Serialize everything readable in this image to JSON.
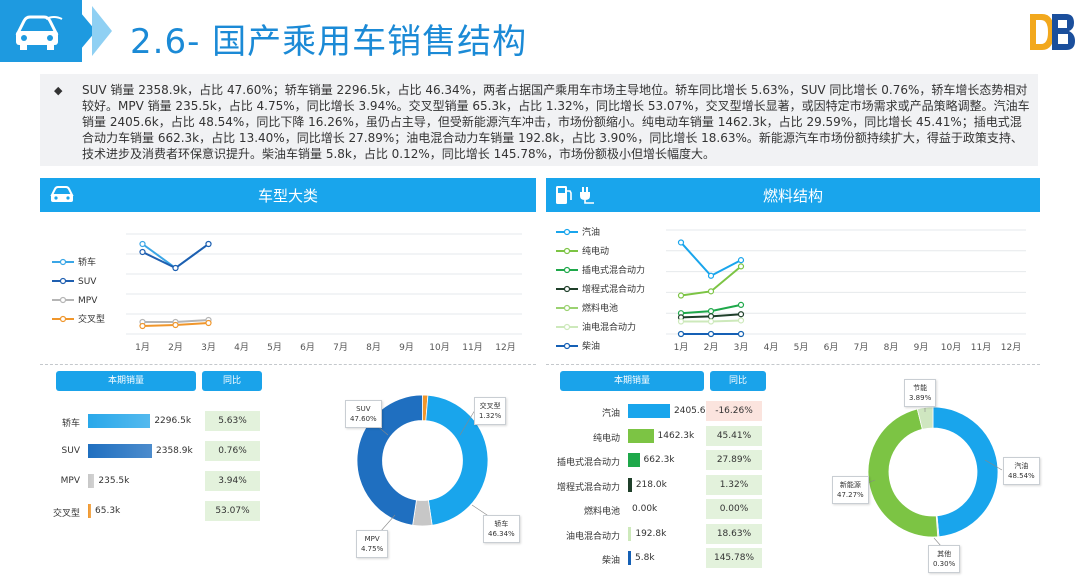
{
  "header": {
    "title": "2.6- 国产乘用车销售结构"
  },
  "summary": {
    "text": "SUV 销量 2358.9k，占比 47.60%；轿车销量 2296.5k，占比 46.34%，两者占据国产乘用车市场主导地位。轿车同比增长 5.63%，SUV 同比增长 0.76%，轿车增长态势相对较好。MPV 销量 235.5k，占比 4.75%，同比增长 3.94%。交叉型销量 65.3k，占比 1.32%，同比增长 53.07%，交叉型增长显著，或因特定市场需求或产品策略调整。汽油车销量 2405.6k，占比 48.54%，同比下降 16.26%，虽仍占主导，但受新能源汽车冲击，市场份额缩小。纯电动车销量 1462.3k，占比 29.59%，同比增长 45.41%；插电式混合动力车销量 662.3k，占比 13.40%，同比增长 27.89%；油电混合动力车销量 192.8k，占比 3.90%，同比增长 18.63%。新能源汽车市场份额持续扩大，得益于政策支持、技术进步及消费者环保意识提升。柴油车销量 5.8k，占比 0.12%，同比增长 145.78%，市场份额极小但增长幅度大。"
  },
  "left": {
    "banner_title": "车型大类",
    "col_sales": "本期销量",
    "col_yoy": "同比",
    "rows": [
      {
        "label": "轿车",
        "sales": "2296.5k",
        "yoy": "5.63%",
        "fraction": 0.974
      },
      {
        "label": "SUV",
        "sales": "2358.9k",
        "yoy": "0.76%",
        "fraction": 1.0
      },
      {
        "label": "MPV",
        "sales": "235.5k",
        "yoy": "3.94%",
        "fraction": 0.1
      },
      {
        "label": "交叉型",
        "sales": "65.3k",
        "yoy": "53.07%",
        "fraction": 0.028
      }
    ],
    "donut_labels": [
      {
        "name": "SUV",
        "pct": "47.60%"
      },
      {
        "name": "交叉型",
        "pct": "1.32%"
      },
      {
        "name": "MPV",
        "pct": "4.75%"
      },
      {
        "name": "轿车",
        "pct": "46.34%"
      }
    ]
  },
  "right": {
    "banner_title": "燃料结构",
    "col_sales": "本期销量",
    "col_yoy": "同比",
    "rows": [
      {
        "label": "汽油",
        "sales": "2405.6k",
        "yoy": "-16.26%",
        "fraction": 1.0
      },
      {
        "label": "纯电动",
        "sales": "1462.3k",
        "yoy": "45.41%",
        "fraction": 0.608
      },
      {
        "label": "插电式混合动力",
        "sales": "662.3k",
        "yoy": "27.89%",
        "fraction": 0.275
      },
      {
        "label": "增程式混合动力",
        "sales": "218.0k",
        "yoy": "1.32%",
        "fraction": 0.091
      },
      {
        "label": "燃料电池",
        "sales": "0.00k",
        "yoy": "0.00%",
        "fraction": 0.0
      },
      {
        "label": "油电混合动力",
        "sales": "192.8k",
        "yoy": "18.63%",
        "fraction": 0.08
      },
      {
        "label": "柴油",
        "sales": "5.8k",
        "yoy": "145.78%",
        "fraction": 0.0024
      }
    ],
    "donut_labels": [
      {
        "name": "节能",
        "pct": "3.89%"
      },
      {
        "name": "汽油",
        "pct": "48.54%"
      },
      {
        "name": "新能源",
        "pct": "47.27%"
      },
      {
        "name": "其他",
        "pct": "0.30%"
      }
    ]
  },
  "chart_data": [
    {
      "type": "line",
      "categories": [
        "1月",
        "2月",
        "3月",
        "4月",
        "5月",
        "6月",
        "7月",
        "8月",
        "9月",
        "10月",
        "11月",
        "12月"
      ],
      "series": [
        {
          "name": "轿车",
          "values": [
            0.9,
            0.66,
            0.9
          ],
          "color": "#3aa6e6"
        },
        {
          "name": "SUV",
          "values": [
            0.82,
            0.66,
            0.9
          ],
          "color": "#1f5fb0"
        },
        {
          "name": "MPV",
          "values": [
            0.12,
            0.12,
            0.14
          ],
          "color": "#b5b5b5"
        },
        {
          "name": "交叉型",
          "values": [
            0.08,
            0.09,
            0.11
          ],
          "color": "#f0962b"
        }
      ],
      "grid": true,
      "legend": "left"
    },
    {
      "type": "line",
      "categories": [
        "1月",
        "2月",
        "3月",
        "4月",
        "5月",
        "6月",
        "7月",
        "8月",
        "9月",
        "10月",
        "11月",
        "12月"
      ],
      "series": [
        {
          "name": "汽油",
          "values": [
            0.88,
            0.56,
            0.71
          ],
          "color": "#19a5ec"
        },
        {
          "name": "纯电动",
          "values": [
            0.37,
            0.41,
            0.65
          ],
          "color": "#7cc444"
        },
        {
          "name": "插电式混合动力",
          "values": [
            0.2,
            0.22,
            0.28
          ],
          "color": "#1ea84a"
        },
        {
          "name": "增程式混合动力",
          "values": [
            0.16,
            0.17,
            0.19
          ],
          "color": "#1f3f2a"
        },
        {
          "name": "燃料电池",
          "values": [
            0.0,
            0.0,
            0.0
          ],
          "color": "#9bd271"
        },
        {
          "name": "油电混合动力",
          "values": [
            0.12,
            0.12,
            0.13
          ],
          "color": "#cde9bb"
        },
        {
          "name": "柴油",
          "values": [
            0.0,
            0.0,
            0.0
          ],
          "color": "#1560b5"
        }
      ],
      "grid": true,
      "legend": "left"
    },
    {
      "type": "pie",
      "categories": [
        "SUV",
        "交叉型",
        "轿车",
        "MPV"
      ],
      "values": [
        47.6,
        1.32,
        46.34,
        4.75
      ],
      "colors": [
        "#1f6fc0",
        "#f0962b",
        "#19a5ec",
        "#c7c7c7"
      ]
    },
    {
      "type": "pie",
      "categories": [
        "汽油",
        "其他",
        "新能源",
        "节能"
      ],
      "values": [
        48.54,
        0.3,
        47.27,
        3.89
      ],
      "colors": [
        "#19a5ec",
        "#c7c7c7",
        "#7cc444",
        "#cfe6c0"
      ]
    }
  ]
}
